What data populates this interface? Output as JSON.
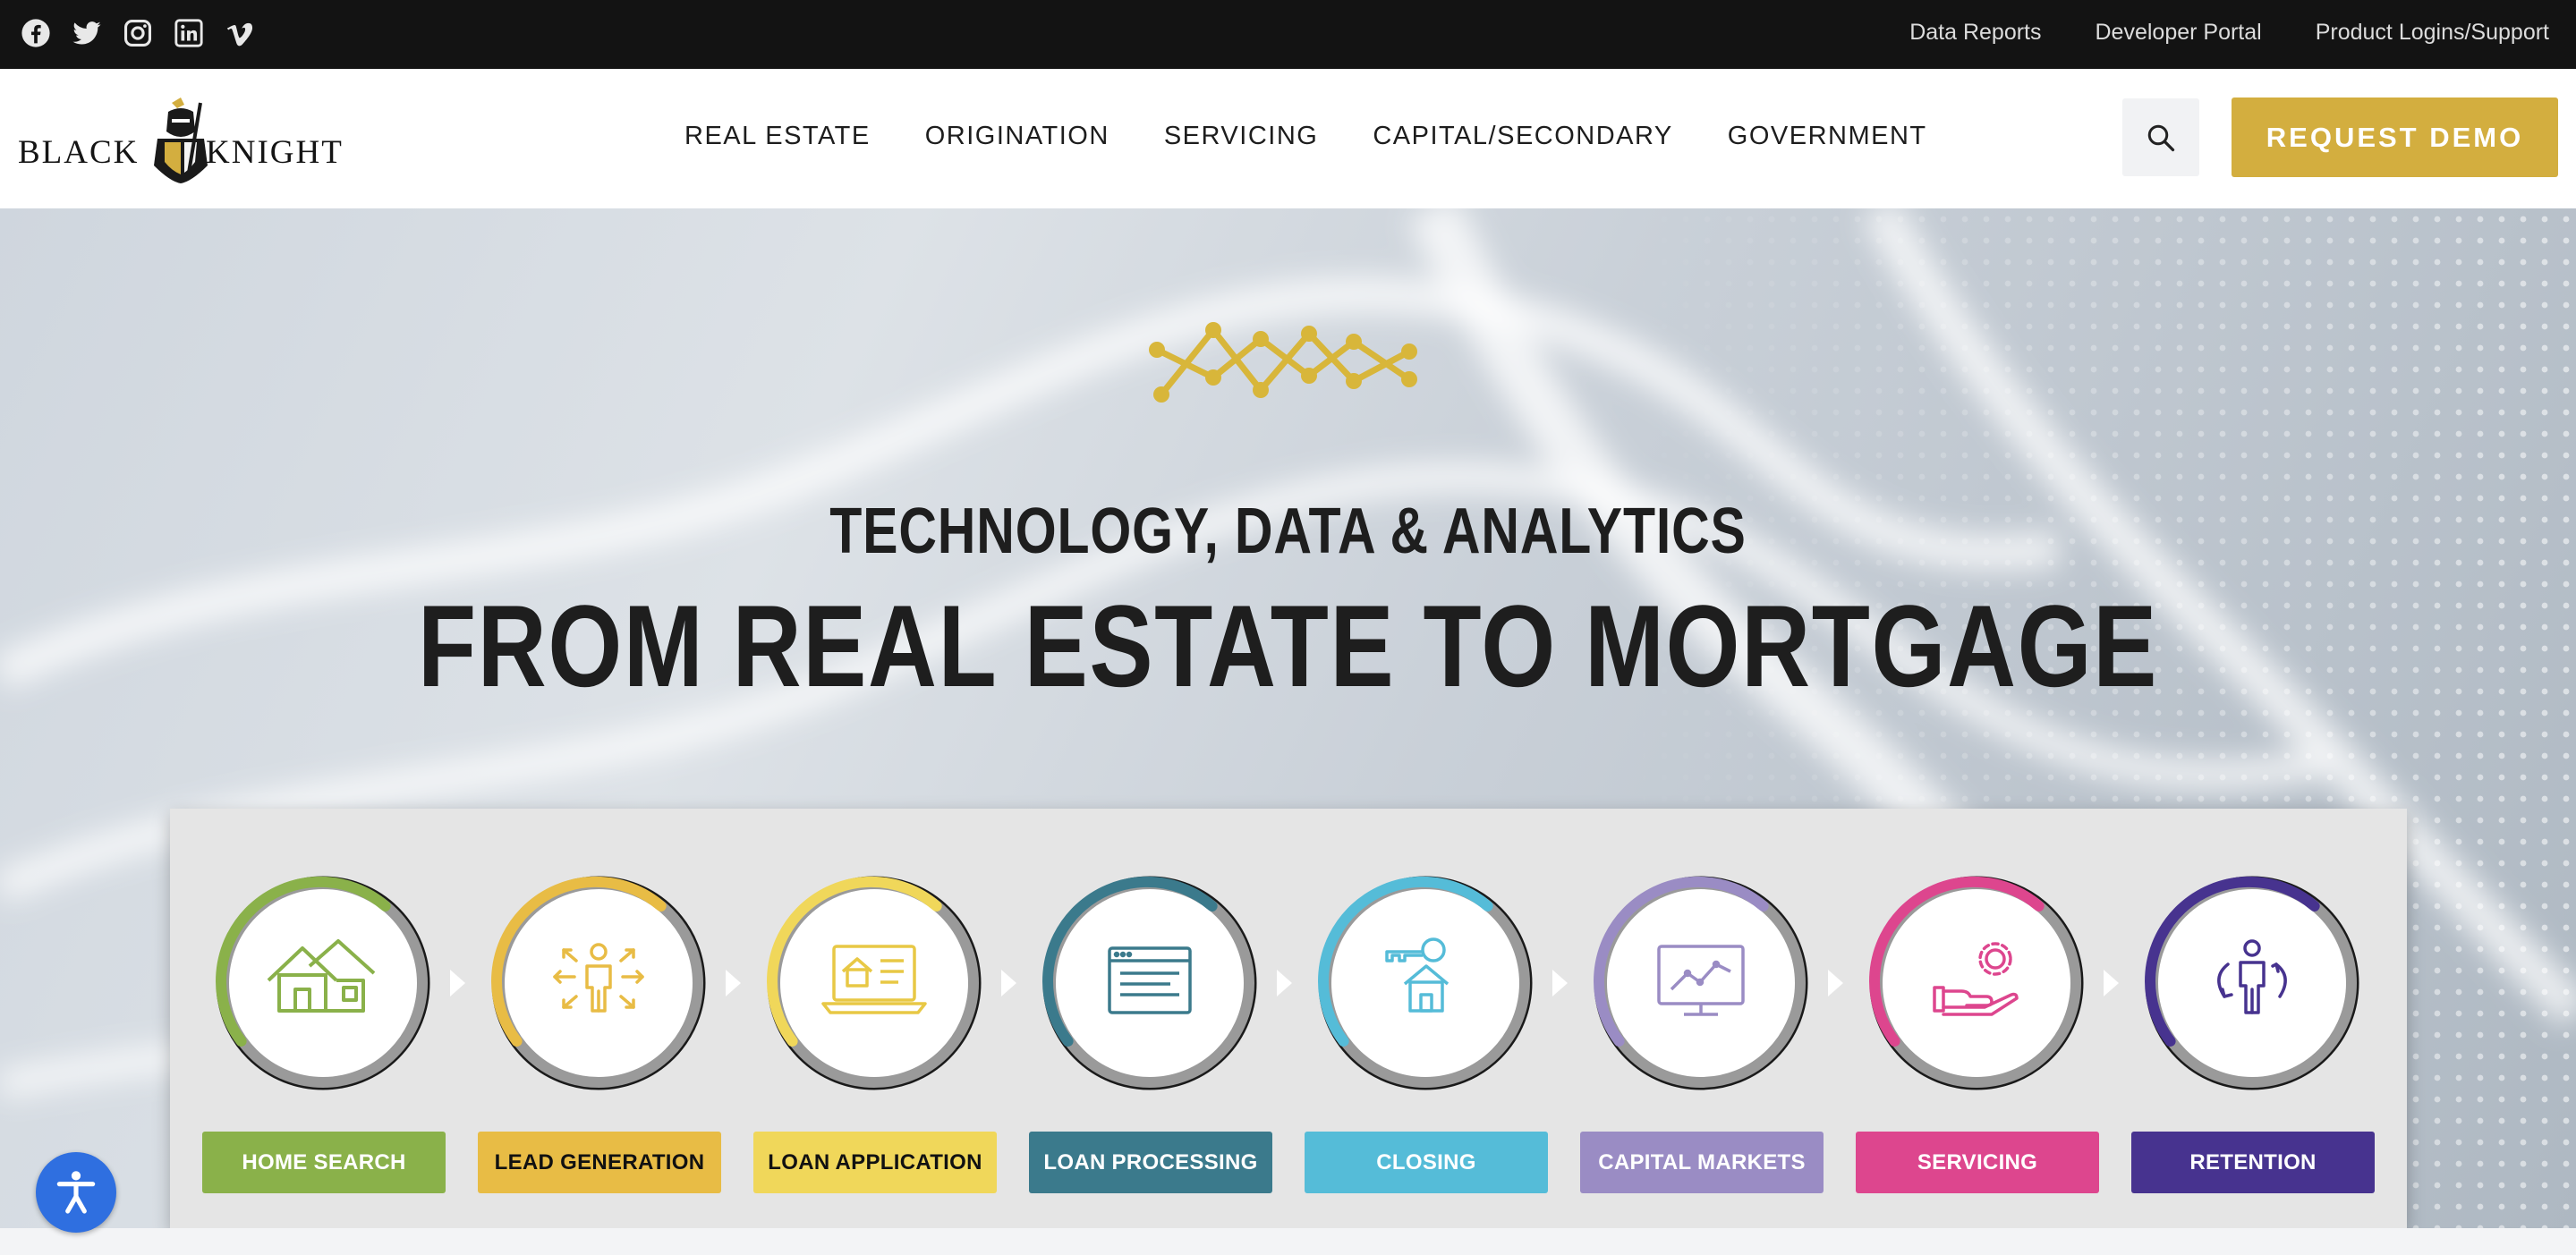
{
  "social": {
    "icons": [
      "facebook-icon",
      "twitter-icon",
      "instagram-icon",
      "linkedin-icon",
      "vimeo-icon"
    ]
  },
  "utility_nav": {
    "data_reports": "Data Reports",
    "developer_portal": "Developer Portal",
    "product_logins": "Product Logins/Support"
  },
  "brand": {
    "word1": "BLACK",
    "word2": "KNIGHT",
    "accent": "#d3ae3f"
  },
  "main_nav": {
    "real_estate": "REAL ESTATE",
    "origination": "ORIGINATION",
    "servicing": "SERVICING",
    "capital_secondary": "CAPITAL/SECONDARY",
    "government": "GOVERNMENT"
  },
  "header": {
    "search_icon": "search-icon",
    "request_demo": "REQUEST DEMO"
  },
  "hero": {
    "tagline_small": "TECHNOLOGY, DATA & ANALYTICS",
    "tagline_large": "FROM REAL ESTATE TO MORTGAGE"
  },
  "process": {
    "steps": [
      {
        "label": "HOME SEARCH",
        "color": "#8ab14a",
        "text_color": "#ffffff",
        "icon": "houses-icon"
      },
      {
        "label": "LEAD GENERATION",
        "color": "#e8bc45",
        "text_color": "#111111",
        "icon": "person-arrows-icon"
      },
      {
        "label": "LOAN APPLICATION",
        "color": "#f0d75a",
        "text_color": "#111111",
        "icon": "laptop-house-icon"
      },
      {
        "label": "LOAN PROCESSING",
        "color": "#3b7a8c",
        "text_color": "#ffffff",
        "icon": "browser-window-icon"
      },
      {
        "label": "CLOSING",
        "color": "#55bcd8",
        "text_color": "#ffffff",
        "icon": "key-house-icon"
      },
      {
        "label": "CAPITAL MARKETS",
        "color": "#9a8cc4",
        "text_color": "#ffffff",
        "icon": "monitor-chart-icon"
      },
      {
        "label": "SERVICING",
        "color": "#dd468e",
        "text_color": "#ffffff",
        "icon": "hand-gear-icon"
      },
      {
        "label": "RETENTION",
        "color": "#47338f",
        "text_color": "#ffffff",
        "icon": "person-cycle-icon"
      }
    ]
  },
  "accessibility": {
    "icon": "accessibility-icon"
  }
}
